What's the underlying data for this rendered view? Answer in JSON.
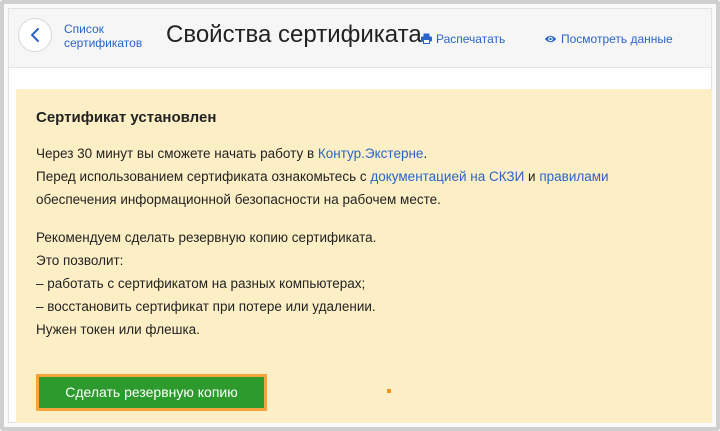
{
  "header": {
    "back_label_line1": "Список",
    "back_label_line2": "сертификатов",
    "title": "Свойства сертификата",
    "print_label": "Распечатать",
    "view_label": "Посмотреть данные"
  },
  "notice": {
    "title": "Сертификат установлен",
    "para1": {
      "l1_pre": "Через 30 минут вы сможете начать работу в ",
      "l1_link": "Контур.Экстерне",
      "l1_post": ".",
      "l2_pre": "Перед использованием сертификата ознакомьтесь с ",
      "l2_link1": "документацией на СКЗИ",
      "l2_mid": " и ",
      "l2_link2": "правилами",
      "l3": "обеспечения информационной безопасности на рабочем месте."
    },
    "para2": [
      "Рекомендуем сделать резервную копию сертификата.",
      "Это позволит:",
      "– работать с сертификатом на разных компьютерах;",
      "– восстановить сертификат при потере или удалении.",
      "Нужен токен или флешка."
    ],
    "button_label": "Сделать резервную копию"
  },
  "colors": {
    "accent_link": "#2a64c8",
    "notice_bg": "#fdefc5",
    "button_bg": "#2d9a2d",
    "button_highlight": "#f7a43a"
  },
  "icons": {
    "back": "chevron-left-icon",
    "print": "printer-icon",
    "view": "eye-icon"
  }
}
